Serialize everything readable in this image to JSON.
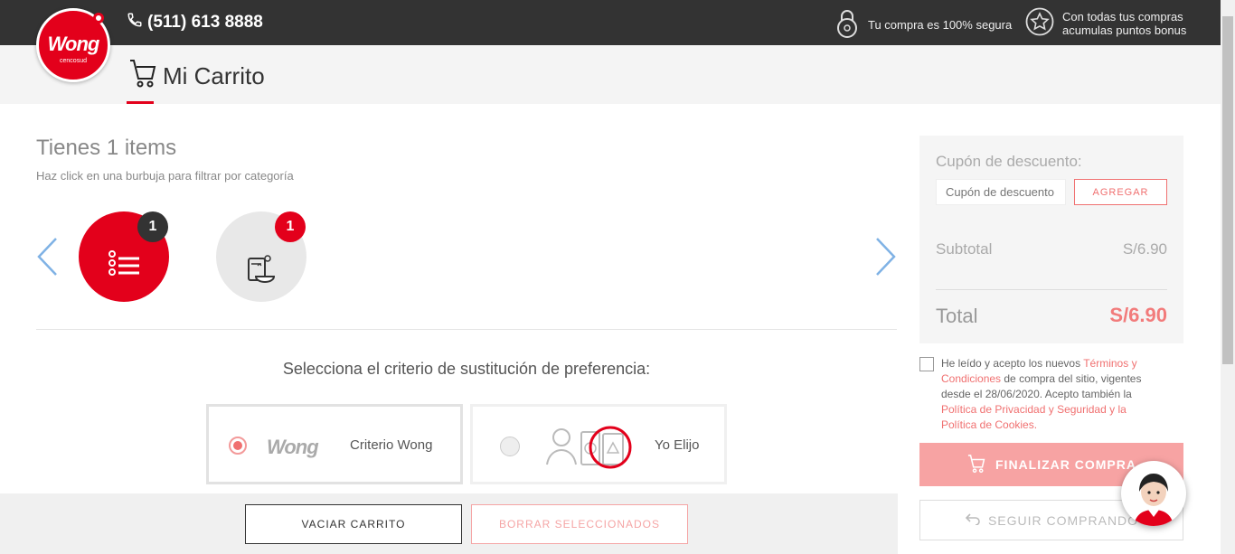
{
  "header": {
    "logo_text": "Wong",
    "logo_sub": "cencosud",
    "phone": "(511) 613 8888",
    "secure_text": "Tu compra es 100% segura",
    "bonus_line1": "Con todas tus compras",
    "bonus_line2": "acumulas puntos bonus",
    "page_title": "Mi Carrito"
  },
  "items": {
    "title": "Tienes 1 items",
    "subtitle": "Haz click en una burbuja para filtrar por categoría",
    "bubbles": [
      {
        "icon": "list-icon",
        "count": "1"
      },
      {
        "icon": "grocery-icon",
        "count": "1"
      }
    ]
  },
  "substitution": {
    "title": "Selecciona el criterio de sustitución de preferencia:",
    "options": [
      {
        "brand": "Wong",
        "label": "Criterio Wong",
        "selected": true
      },
      {
        "label": "Yo Elijo",
        "selected": false
      }
    ]
  },
  "actions": {
    "empty_cart": "VACIAR CARRITO",
    "delete_selected": "BORRAR SELECCIONADOS"
  },
  "summary": {
    "coupon_label": "Cupón de descuento:",
    "coupon_placeholder": "Cupón de descuento",
    "coupon_button": "AGREGAR",
    "subtotal_label": "Subtotal",
    "subtotal_value": "S/6.90",
    "total_label": "Total",
    "total_value": "S/6.90"
  },
  "terms": {
    "text1": "He leído y acepto los nuevos ",
    "link1": "Términos y Condiciones",
    "text2": " de compra del sitio, vigentes desde el 28/06/2020. Acepto también la ",
    "link2": "Política de Privacidad y Seguridad y la Política de Cookies."
  },
  "checkout": {
    "finish": "FINALIZAR COMPRA",
    "continue": "SEGUIR COMPRANDO"
  },
  "colors": {
    "brand_red": "#e3001b",
    "topbar": "#333333",
    "accent_light": "#f7a3a3"
  }
}
